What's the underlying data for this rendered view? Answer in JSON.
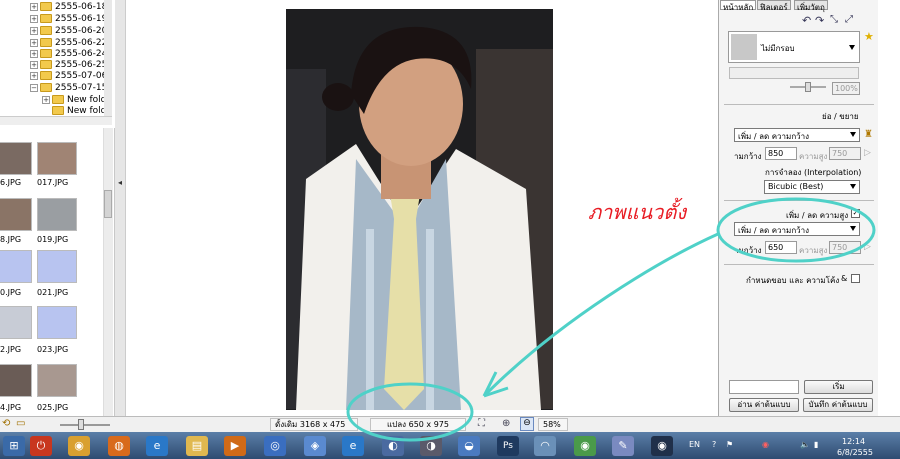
{
  "tree": {
    "items": [
      {
        "label": "2555-06-18"
      },
      {
        "label": "2555-06-19"
      },
      {
        "label": "2555-06-20"
      },
      {
        "label": "2555-06-22"
      },
      {
        "label": "2555-06-24"
      },
      {
        "label": "2555-06-25"
      },
      {
        "label": "2555-07-06"
      },
      {
        "label": "2555-07-15"
      },
      {
        "label": "New fold"
      },
      {
        "label": "New fold"
      }
    ]
  },
  "thumbs": [
    {
      "label": "6.JPG"
    },
    {
      "label": "017.JPG"
    },
    {
      "label": "8.JPG"
    },
    {
      "label": "019.JPG"
    },
    {
      "label": "0.JPG"
    },
    {
      "label": "021.JPG"
    },
    {
      "label": "2.JPG"
    },
    {
      "label": "023.JPG"
    },
    {
      "label": "4.JPG"
    },
    {
      "label": "025.JPG"
    }
  ],
  "panel": {
    "tabs": [
      "หน้าหลัก",
      "ฟิลเตอร์",
      "เพิ่มวัตถุ"
    ],
    "frame_select": "ไม่มีกรอบ",
    "opacity": "100%",
    "resize_heading": "ย่อ / ขยาย",
    "resize_mode": "เพิ่ม / ลด ความกว้าง",
    "width_label": "ามกว้าง",
    "width_value": "850",
    "height_label": "ความสูง",
    "height_value": "750",
    "interp_label": "การจำลอง (Interpolation)",
    "interp_value": "Bicubic (Best)",
    "portrait_check_label": "เพิ่ม / ลด ความสูง",
    "portrait_mode": "เพิ่ม / ลด ความกว้าง",
    "portrait_width_label": "ามกว้าง",
    "portrait_width_value": "650",
    "portrait_height_label": "ความสูง",
    "portrait_height_value": "750",
    "border_label": "กำหนดขอบ และ ความโค้ง",
    "border_amp": "&",
    "start_button": "เริ่ม",
    "read_button": "อ่าน ค่าต้นแบบ",
    "save_button": "บันทึก ค่าต้นแบบ"
  },
  "status": {
    "original": "ดั้งเดิม 3168 x 475",
    "converted": "แปลง 650 x 975",
    "zoom": "58%"
  },
  "annotation": {
    "text": "ภาพแนวตั้ง",
    "color": "#e81c24",
    "highlight_color": "#4fd1c8"
  },
  "taskbar": {
    "lang": "EN",
    "time": "12:14",
    "date": "6/8/2555",
    "icons": [
      "power-icon",
      "chrome-icon",
      "firefox-icon",
      "ie-icon",
      "folder-icon",
      "media-icon",
      "photoshop-icon",
      "paint-icon"
    ]
  }
}
